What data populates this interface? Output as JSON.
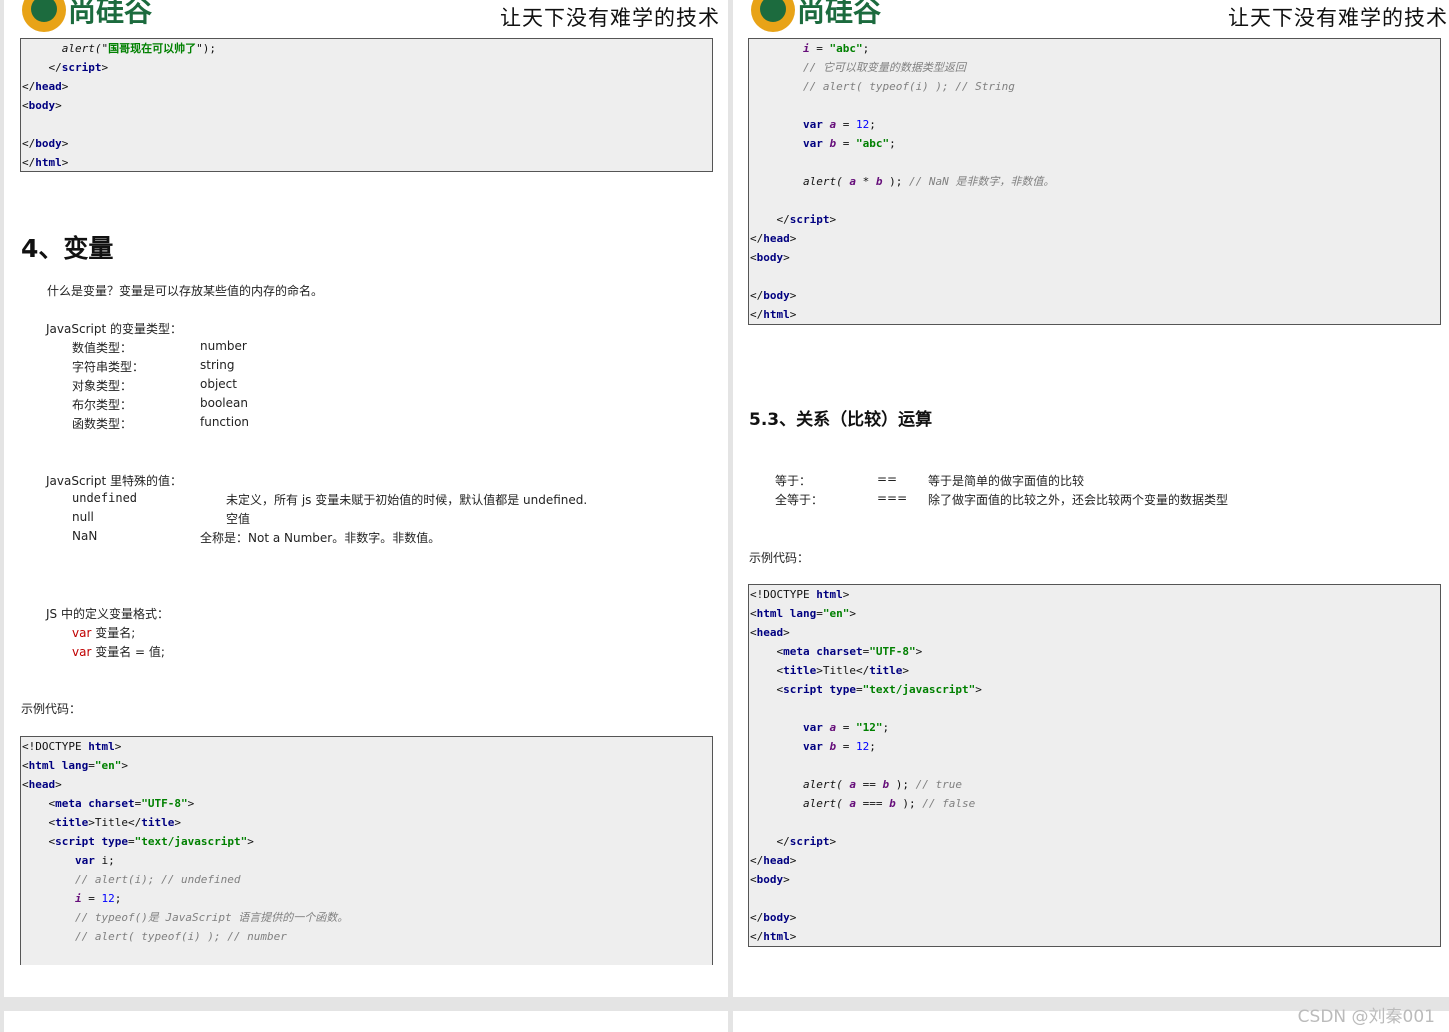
{
  "header": {
    "logo_text": "尚硅谷",
    "slogan": "让天下没有难学的技术"
  },
  "left": {
    "code_top": [
      [
        {
          "t": "      alert(\"",
          "c": "it"
        },
        {
          "t": "国哥现在可以帅了",
          "c": "str"
        },
        {
          "t": "\");",
          "c": ""
        }
      ],
      [
        {
          "t": "    </",
          "c": ""
        },
        {
          "t": "script",
          "c": "tag"
        },
        {
          "t": ">",
          "c": ""
        }
      ],
      [
        {
          "t": "</",
          "c": ""
        },
        {
          "t": "head",
          "c": "tag"
        },
        {
          "t": ">",
          "c": ""
        }
      ],
      [
        {
          "t": "<",
          "c": ""
        },
        {
          "t": "body",
          "c": "tag"
        },
        {
          "t": ">",
          "c": ""
        }
      ],
      [
        {
          "t": "",
          "c": ""
        }
      ],
      [
        {
          "t": "</",
          "c": ""
        },
        {
          "t": "body",
          "c": "tag"
        },
        {
          "t": ">",
          "c": ""
        }
      ],
      [
        {
          "t": "</",
          "c": ""
        },
        {
          "t": "html",
          "c": "tag"
        },
        {
          "t": ">",
          "c": ""
        }
      ]
    ],
    "heading": "4、变量",
    "intro": "什么是变量？变量是可以存放某些值的内存的命名。",
    "types_title": "JavaScript 的变量类型：",
    "types": [
      {
        "label": "数值类型：",
        "value": "number"
      },
      {
        "label": "字符串类型：",
        "value": "string"
      },
      {
        "label": "对象类型：",
        "value": "object"
      },
      {
        "label": "布尔类型：",
        "value": "boolean"
      },
      {
        "label": "函数类型：",
        "value": "function"
      }
    ],
    "special_title": "JavaScript 里特殊的值：",
    "special": [
      {
        "label": "undefined",
        "desc": "未定义，所有 js 变量未赋于初始值的时候，默认值都是 undefined."
      },
      {
        "label": "null",
        "desc": "空值"
      },
      {
        "label": "NaN",
        "desc": "全称是：Not a Number。非数字。非数值。"
      }
    ],
    "define_title": "JS 中的定义变量格式：",
    "define_lines": [
      {
        "kw": "var",
        "rest": " 变量名;"
      },
      {
        "kw": "var",
        "rest": " 变量名 = 值;"
      }
    ],
    "example_label": "示例代码：",
    "code_bottom": [
      [
        {
          "t": "<!DOCTYPE ",
          "c": ""
        },
        {
          "t": "html",
          "c": "tag"
        },
        {
          "t": ">",
          "c": ""
        }
      ],
      [
        {
          "t": "<",
          "c": ""
        },
        {
          "t": "html ",
          "c": "tag"
        },
        {
          "t": "lang",
          "c": "kw"
        },
        {
          "t": "=",
          "c": ""
        },
        {
          "t": "\"en\"",
          "c": "str"
        },
        {
          "t": ">",
          "c": ""
        }
      ],
      [
        {
          "t": "<",
          "c": ""
        },
        {
          "t": "head",
          "c": "tag"
        },
        {
          "t": ">",
          "c": ""
        }
      ],
      [
        {
          "t": "    <",
          "c": ""
        },
        {
          "t": "meta ",
          "c": "tag"
        },
        {
          "t": "charset",
          "c": "kw"
        },
        {
          "t": "=",
          "c": ""
        },
        {
          "t": "\"UTF-8\"",
          "c": "str"
        },
        {
          "t": ">",
          "c": ""
        }
      ],
      [
        {
          "t": "    <",
          "c": ""
        },
        {
          "t": "title",
          "c": "tag"
        },
        {
          "t": ">Title</",
          "c": ""
        },
        {
          "t": "title",
          "c": "tag"
        },
        {
          "t": ">",
          "c": ""
        }
      ],
      [
        {
          "t": "    <",
          "c": ""
        },
        {
          "t": "script ",
          "c": "tag"
        },
        {
          "t": "type",
          "c": "kw"
        },
        {
          "t": "=",
          "c": ""
        },
        {
          "t": "\"text/javascript\"",
          "c": "str"
        },
        {
          "t": ">",
          "c": ""
        }
      ],
      [
        {
          "t": "        ",
          "c": ""
        },
        {
          "t": "var ",
          "c": "kw"
        },
        {
          "t": "i;",
          "c": ""
        }
      ],
      [
        {
          "t": "        // alert(i); // undefined",
          "c": "cmt"
        }
      ],
      [
        {
          "t": "        ",
          "c": ""
        },
        {
          "t": "i",
          "c": "var"
        },
        {
          "t": " = ",
          "c": ""
        },
        {
          "t": "12",
          "c": "num"
        },
        {
          "t": ";",
          "c": ""
        }
      ],
      [
        {
          "t": "        // typeof()是 JavaScript 语言提供的一个函数。",
          "c": "cmt"
        }
      ],
      [
        {
          "t": "        // alert( typeof(i) ); // number",
          "c": "cmt"
        }
      ]
    ]
  },
  "right": {
    "code_top": [
      [
        {
          "t": "        ",
          "c": ""
        },
        {
          "t": "i",
          "c": "var"
        },
        {
          "t": " = ",
          "c": ""
        },
        {
          "t": "\"abc\"",
          "c": "str"
        },
        {
          "t": ";",
          "c": ""
        }
      ],
      [
        {
          "t": "        // 它可以取变量的数据类型返回",
          "c": "cmt"
        }
      ],
      [
        {
          "t": "        // alert( typeof(i) ); // String",
          "c": "cmt"
        }
      ],
      [
        {
          "t": "",
          "c": ""
        }
      ],
      [
        {
          "t": "        ",
          "c": ""
        },
        {
          "t": "var ",
          "c": "kw"
        },
        {
          "t": "a",
          "c": "var"
        },
        {
          "t": " = ",
          "c": ""
        },
        {
          "t": "12",
          "c": "num"
        },
        {
          "t": ";",
          "c": ""
        }
      ],
      [
        {
          "t": "        ",
          "c": ""
        },
        {
          "t": "var ",
          "c": "kw"
        },
        {
          "t": "b",
          "c": "var"
        },
        {
          "t": " = ",
          "c": ""
        },
        {
          "t": "\"abc\"",
          "c": "str"
        },
        {
          "t": ";",
          "c": ""
        }
      ],
      [
        {
          "t": "",
          "c": ""
        }
      ],
      [
        {
          "t": "        alert( ",
          "c": "it"
        },
        {
          "t": "a",
          "c": "var"
        },
        {
          "t": " * ",
          "c": ""
        },
        {
          "t": "b",
          "c": "var"
        },
        {
          "t": " ); ",
          "c": ""
        },
        {
          "t": "// NaN 是非数字，非数值。",
          "c": "cmt"
        }
      ],
      [
        {
          "t": "",
          "c": ""
        }
      ],
      [
        {
          "t": "    </",
          "c": ""
        },
        {
          "t": "script",
          "c": "tag"
        },
        {
          "t": ">",
          "c": ""
        }
      ],
      [
        {
          "t": "</",
          "c": ""
        },
        {
          "t": "head",
          "c": "tag"
        },
        {
          "t": ">",
          "c": ""
        }
      ],
      [
        {
          "t": "<",
          "c": ""
        },
        {
          "t": "body",
          "c": "tag"
        },
        {
          "t": ">",
          "c": ""
        }
      ],
      [
        {
          "t": "",
          "c": ""
        }
      ],
      [
        {
          "t": "</",
          "c": ""
        },
        {
          "t": "body",
          "c": "tag"
        },
        {
          "t": ">",
          "c": ""
        }
      ],
      [
        {
          "t": "</",
          "c": ""
        },
        {
          "t": "html",
          "c": "tag"
        },
        {
          "t": ">",
          "c": ""
        }
      ]
    ],
    "heading": "5.3、关系（比较）运算",
    "ops": [
      {
        "label": "等于：",
        "op": "==",
        "desc": "等于是简单的做字面值的比较"
      },
      {
        "label": "全等于：",
        "op": "===",
        "desc": "除了做字面值的比较之外，还会比较两个变量的数据类型"
      }
    ],
    "example_label": "示例代码：",
    "code_bottom": [
      [
        {
          "t": "<!DOCTYPE ",
          "c": ""
        },
        {
          "t": "html",
          "c": "tag"
        },
        {
          "t": ">",
          "c": ""
        }
      ],
      [
        {
          "t": "<",
          "c": ""
        },
        {
          "t": "html ",
          "c": "tag"
        },
        {
          "t": "lang",
          "c": "kw"
        },
        {
          "t": "=",
          "c": ""
        },
        {
          "t": "\"en\"",
          "c": "str"
        },
        {
          "t": ">",
          "c": ""
        }
      ],
      [
        {
          "t": "<",
          "c": ""
        },
        {
          "t": "head",
          "c": "tag"
        },
        {
          "t": ">",
          "c": ""
        }
      ],
      [
        {
          "t": "    <",
          "c": ""
        },
        {
          "t": "meta ",
          "c": "tag"
        },
        {
          "t": "charset",
          "c": "kw"
        },
        {
          "t": "=",
          "c": ""
        },
        {
          "t": "\"UTF-8\"",
          "c": "str"
        },
        {
          "t": ">",
          "c": ""
        }
      ],
      [
        {
          "t": "    <",
          "c": ""
        },
        {
          "t": "title",
          "c": "tag"
        },
        {
          "t": ">Title</",
          "c": ""
        },
        {
          "t": "title",
          "c": "tag"
        },
        {
          "t": ">",
          "c": ""
        }
      ],
      [
        {
          "t": "    <",
          "c": ""
        },
        {
          "t": "script ",
          "c": "tag"
        },
        {
          "t": "type",
          "c": "kw"
        },
        {
          "t": "=",
          "c": ""
        },
        {
          "t": "\"text/javascript\"",
          "c": "str"
        },
        {
          "t": ">",
          "c": ""
        }
      ],
      [
        {
          "t": "",
          "c": ""
        }
      ],
      [
        {
          "t": "        ",
          "c": ""
        },
        {
          "t": "var ",
          "c": "kw"
        },
        {
          "t": "a",
          "c": "var"
        },
        {
          "t": " = ",
          "c": ""
        },
        {
          "t": "\"12\"",
          "c": "str"
        },
        {
          "t": ";",
          "c": ""
        }
      ],
      [
        {
          "t": "        ",
          "c": ""
        },
        {
          "t": "var ",
          "c": "kw"
        },
        {
          "t": "b",
          "c": "var"
        },
        {
          "t": " = ",
          "c": ""
        },
        {
          "t": "12",
          "c": "num"
        },
        {
          "t": ";",
          "c": ""
        }
      ],
      [
        {
          "t": "",
          "c": ""
        }
      ],
      [
        {
          "t": "        alert( ",
          "c": "it"
        },
        {
          "t": "a",
          "c": "var"
        },
        {
          "t": " == ",
          "c": ""
        },
        {
          "t": "b",
          "c": "var"
        },
        {
          "t": " ); ",
          "c": ""
        },
        {
          "t": "// true",
          "c": "cmt"
        }
      ],
      [
        {
          "t": "        alert( ",
          "c": "it"
        },
        {
          "t": "a",
          "c": "var"
        },
        {
          "t": " === ",
          "c": ""
        },
        {
          "t": "b",
          "c": "var"
        },
        {
          "t": " ); ",
          "c": ""
        },
        {
          "t": "// false",
          "c": "cmt"
        }
      ],
      [
        {
          "t": "",
          "c": ""
        }
      ],
      [
        {
          "t": "    </",
          "c": ""
        },
        {
          "t": "script",
          "c": "tag"
        },
        {
          "t": ">",
          "c": ""
        }
      ],
      [
        {
          "t": "</",
          "c": ""
        },
        {
          "t": "head",
          "c": "tag"
        },
        {
          "t": ">",
          "c": ""
        }
      ],
      [
        {
          "t": "<",
          "c": ""
        },
        {
          "t": "body",
          "c": "tag"
        },
        {
          "t": ">",
          "c": ""
        }
      ],
      [
        {
          "t": "",
          "c": ""
        }
      ],
      [
        {
          "t": "</",
          "c": ""
        },
        {
          "t": "body",
          "c": "tag"
        },
        {
          "t": ">",
          "c": ""
        }
      ],
      [
        {
          "t": "</",
          "c": ""
        },
        {
          "t": "html",
          "c": "tag"
        },
        {
          "t": ">",
          "c": ""
        }
      ]
    ]
  },
  "watermark": "CSDN @刘秦001",
  "colors": {
    "code_bg": "#eeeeee",
    "tag": "#000080",
    "string": "#008000",
    "comment": "#808080",
    "keyword_var": "#c00000",
    "brand_green": "#1c6b3e",
    "brand_orange": "#e8a317"
  }
}
